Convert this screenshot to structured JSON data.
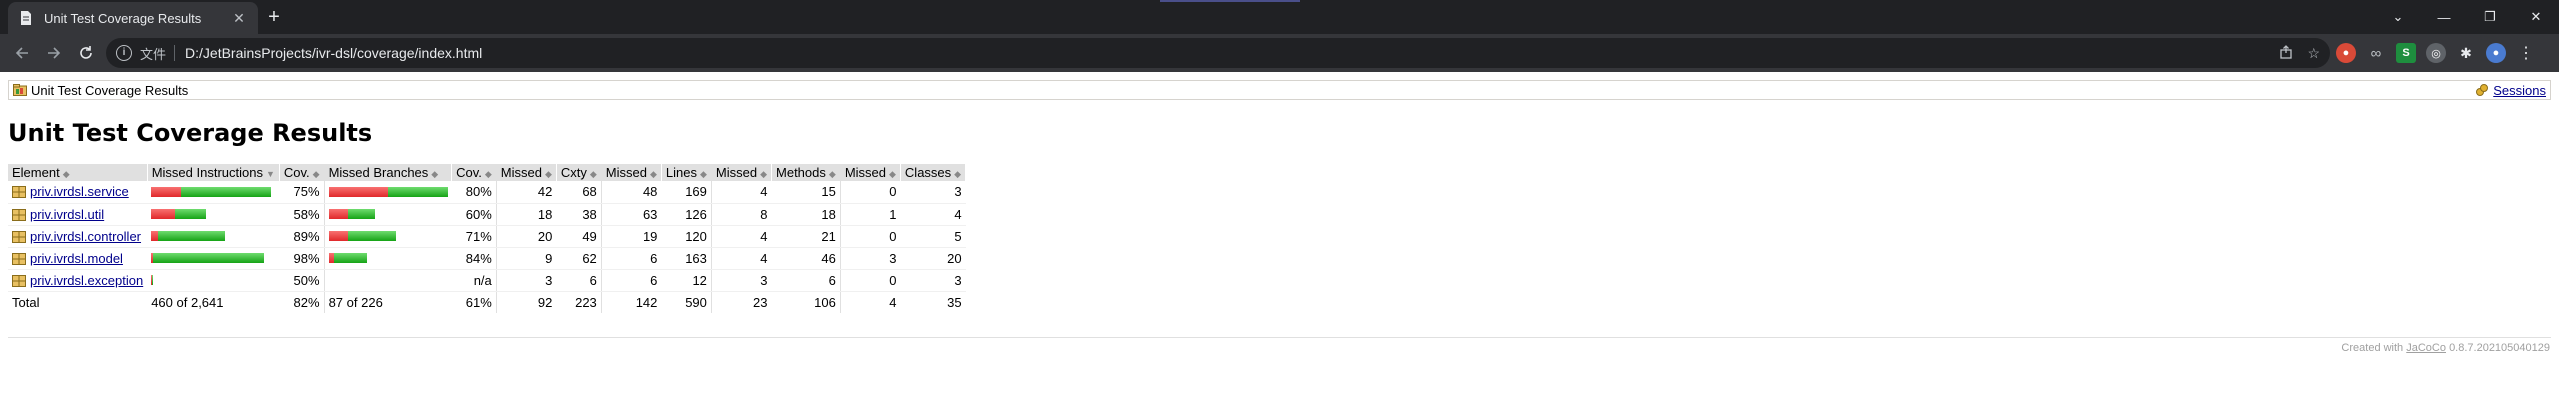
{
  "browser": {
    "tab_title": "Unit Test Coverage Results",
    "scheme_label": "文件",
    "url": "D:/JetBrainsProjects/ivr-dsl/coverage/index.html",
    "window_controls": [
      "⌄",
      "—",
      "❐",
      "✕"
    ]
  },
  "page": {
    "breadcrumb": "Unit Test Coverage Results",
    "sessions_label": "Sessions",
    "title": "Unit Test Coverage Results",
    "footer_prefix": "Created with",
    "footer_link": "JaCoCo",
    "footer_version": "0.8.7.202105040129"
  },
  "table": {
    "headers": {
      "element": "Element",
      "missed_instructions": "Missed Instructions",
      "cov_instr": "Cov.",
      "missed_branches": "Missed Branches",
      "cov_branch": "Cov.",
      "missed_cxty": "Missed",
      "cxty": "Cxty",
      "missed_lines": "Missed",
      "lines": "Lines",
      "missed_methods": "Missed",
      "methods": "Methods",
      "missed_classes": "Missed",
      "classes": "Classes"
    },
    "rows": [
      {
        "name": "priv.ivrdsl.service",
        "instr_cov": "75%",
        "branch_cov": "80%",
        "missed_cxty": "42",
        "cxty": "68",
        "missed_lines": "48",
        "lines": "169",
        "missed_methods": "4",
        "methods": "15",
        "missed_classes": "0",
        "classes": "3"
      },
      {
        "name": "priv.ivrdsl.util",
        "instr_cov": "58%",
        "branch_cov": "60%",
        "missed_cxty": "18",
        "cxty": "38",
        "missed_lines": "63",
        "lines": "126",
        "missed_methods": "8",
        "methods": "18",
        "missed_classes": "1",
        "classes": "4"
      },
      {
        "name": "priv.ivrdsl.controller",
        "instr_cov": "89%",
        "branch_cov": "71%",
        "missed_cxty": "20",
        "cxty": "49",
        "missed_lines": "19",
        "lines": "120",
        "missed_methods": "4",
        "methods": "21",
        "missed_classes": "0",
        "classes": "5"
      },
      {
        "name": "priv.ivrdsl.model",
        "instr_cov": "98%",
        "branch_cov": "84%",
        "missed_cxty": "9",
        "cxty": "62",
        "missed_lines": "6",
        "lines": "163",
        "missed_methods": "4",
        "methods": "46",
        "missed_classes": "3",
        "classes": "20"
      },
      {
        "name": "priv.ivrdsl.exception",
        "instr_cov": "50%",
        "branch_cov": "n/a",
        "missed_cxty": "3",
        "cxty": "6",
        "missed_lines": "6",
        "lines": "12",
        "missed_methods": "3",
        "methods": "6",
        "missed_classes": "0",
        "classes": "3"
      }
    ],
    "total": {
      "label": "Total",
      "missed_instructions": "460 of 2,641",
      "instr_cov": "82%",
      "missed_branches": "87 of 226",
      "branch_cov": "61%",
      "missed_cxty": "92",
      "cxty": "223",
      "missed_lines": "142",
      "lines": "590",
      "missed_methods": "23",
      "methods": "106",
      "missed_classes": "4",
      "classes": "35"
    }
  },
  "colors": {
    "missed_bar": "#e0282a",
    "covered_bar": "#16a316",
    "link": "#00008b",
    "header_bg": "#e0e0e0"
  }
}
